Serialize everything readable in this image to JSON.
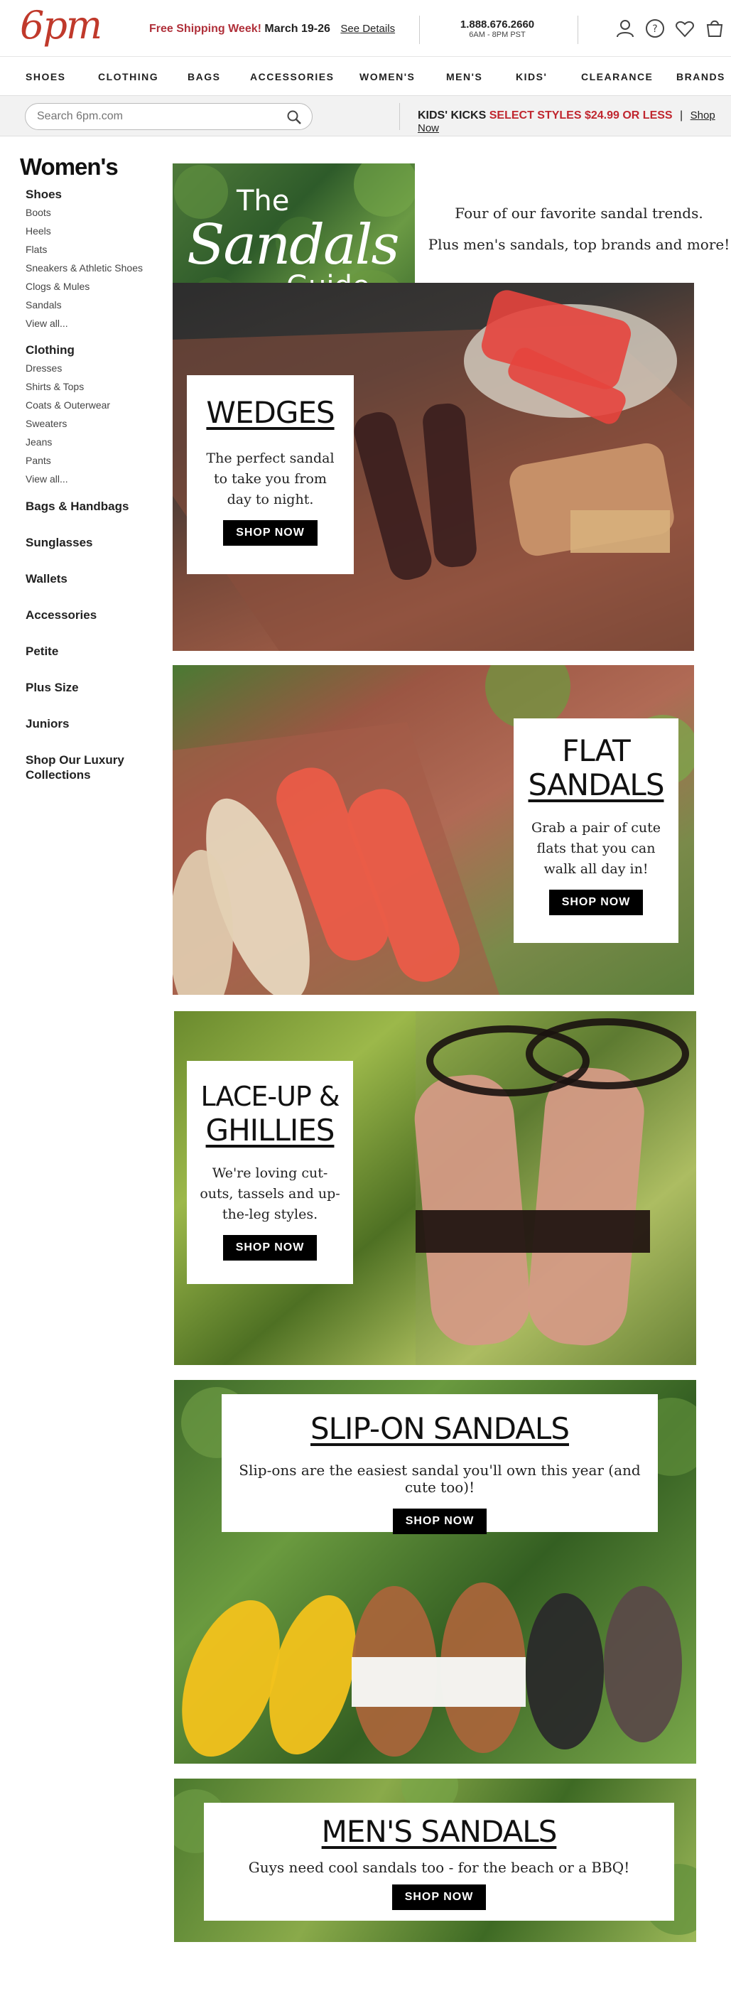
{
  "header": {
    "logo": "6pm",
    "promo_bold": "Free Shipping Week!",
    "promo_dates": "March 19-26",
    "promo_link": "See Details",
    "phone": "1.888.676.2660",
    "hours": "6AM - 8PM PST"
  },
  "nav": [
    "SHOES",
    "CLOTHING",
    "BAGS",
    "ACCESSORIES",
    "WOMEN'S",
    "MEN'S",
    "KIDS'",
    "CLEARANCE",
    "BRANDS"
  ],
  "search": {
    "placeholder": "Search 6pm.com"
  },
  "kids_promo": {
    "label": "KIDS' KICKS",
    "offer": "SELECT STYLES $24.99 OR LESS",
    "separator": "|",
    "link": "Shop Now"
  },
  "sidebar": {
    "title": "Women's",
    "shoes": {
      "label": "Shoes",
      "items": [
        "Boots",
        "Heels",
        "Flats",
        "Sneakers & Athletic Shoes",
        "Clogs & Mules",
        "Sandals",
        "View all..."
      ]
    },
    "clothing": {
      "label": "Clothing",
      "items": [
        "Dresses",
        "Shirts & Tops",
        "Coats & Outerwear",
        "Sweaters",
        "Jeans",
        "Pants",
        "View all..."
      ]
    },
    "categories": [
      "Bags & Handbags",
      "Sunglasses",
      "Wallets",
      "Accessories",
      "Petite",
      "Plus Size",
      "Juniors",
      "Shop Our Luxury Collections"
    ]
  },
  "intro": {
    "guide_the": "The",
    "guide_sandals": "Sandals",
    "guide_guide": "Guide",
    "line1": "Four of our favorite sandal trends.",
    "line2": "Plus men's sandals, top brands and more!"
  },
  "panels": {
    "wedges": {
      "title": "WEDGES",
      "text": "The perfect sandal to take you from day to night.",
      "button": "SHOP NOW"
    },
    "flat": {
      "title_line1": "FLAT",
      "title_line2": "SANDALS",
      "text": "Grab a pair of cute flats that you can walk all day in!",
      "button": "SHOP NOW"
    },
    "laceup": {
      "title_line1": "LACE-UP &",
      "title_line2": "GHILLIES",
      "text": "We're loving cut-outs, tassels and up-the-leg styles.",
      "button": "SHOP NOW"
    },
    "slipon": {
      "title": "SLIP-ON SANDALS",
      "text": "Slip-ons are the easiest sandal you'll own this year (and cute too)!",
      "button": "SHOP NOW"
    },
    "mens": {
      "title": "MEN'S SANDALS",
      "text": "Guys need cool sandals too - for the beach or a BBQ!",
      "button": "SHOP NOW"
    }
  },
  "colors": {
    "brand_red": "#c0392b",
    "promo_red": "#b0303a",
    "button_black": "#000000"
  }
}
